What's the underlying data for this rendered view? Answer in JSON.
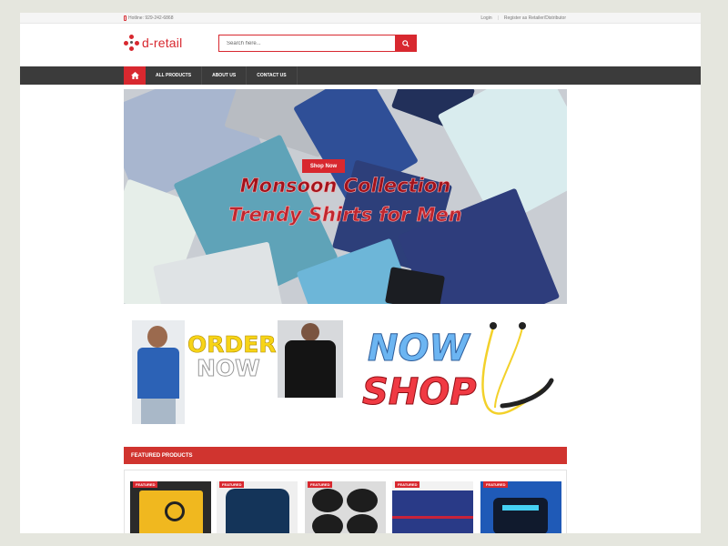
{
  "topbar": {
    "hotline": "Hotline: 929-242-6868",
    "login": "Login",
    "separator": "|",
    "register": "Register as Retailer/Distributor"
  },
  "brand": {
    "name": "d-retail",
    "accent": "#d8282f"
  },
  "search": {
    "placeholder": "Search here..."
  },
  "nav": {
    "home_icon": "home-icon",
    "items": [
      "ALL PRODUCTS",
      "ABOUT US",
      "CONTACT US"
    ]
  },
  "banner": {
    "button": "Shop Now",
    "headline_1": "Monsoon Collection",
    "headline_2": "Trendy Shirts for Men"
  },
  "promo": {
    "word_1": "ORDER",
    "word_2": "NOW",
    "word_3": "NOW",
    "word_4": "SHOP"
  },
  "featured": {
    "title": "FEATURED PRODUCTS",
    "badge": "FEATURED",
    "products": [
      {
        "name": "earphones"
      },
      {
        "name": "navy-tshirt"
      },
      {
        "name": "earphone-cases"
      },
      {
        "name": "polo-shirt"
      },
      {
        "name": "wireless-earbuds"
      }
    ]
  }
}
